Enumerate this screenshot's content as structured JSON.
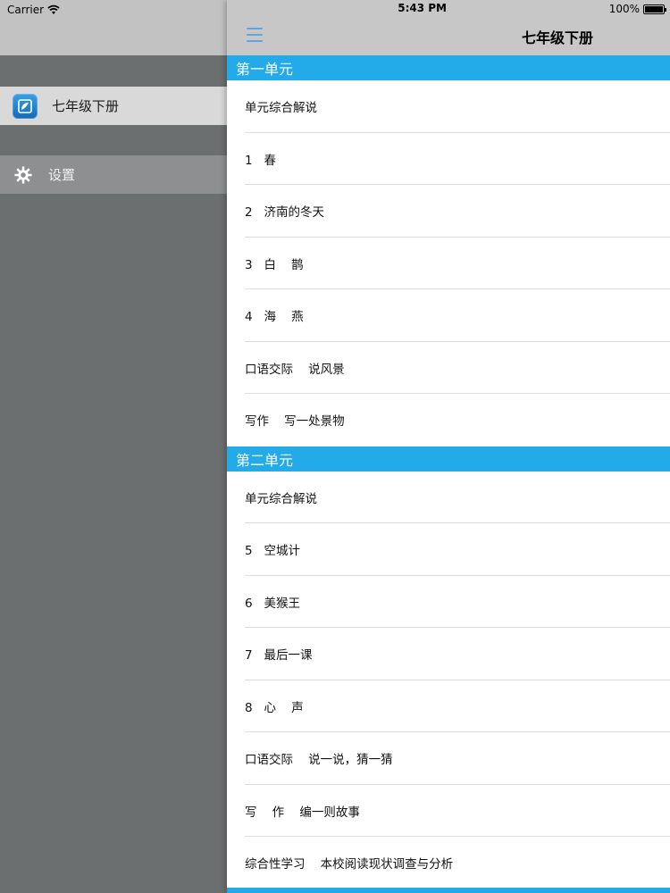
{
  "status": {
    "carrier": "Carrier",
    "time": "5:43 PM",
    "battery": "100%"
  },
  "sidebar": {
    "items": [
      {
        "label": "七年级下册",
        "icon": "book-app-icon"
      },
      {
        "label": "设置",
        "icon": "gear-icon"
      }
    ]
  },
  "header": {
    "title": "七年级下册",
    "menu_icon": "hamburger-menu-icon"
  },
  "sections": [
    {
      "title": "第一单元",
      "rows": [
        "单元综合解说",
        "1   春",
        "2   济南的冬天",
        "3   白    鹊",
        "4   海    燕",
        "口语交际    说风景",
        "写作    写一处景物"
      ]
    },
    {
      "title": "第二单元",
      "rows": [
        "单元综合解说",
        "5   空城计",
        "6   美猴王",
        "7   最后一课",
        "8   心    声",
        "口语交际    说一说，猜一猜",
        "写    作    编一则故事",
        "综合性学习    本校阅读现状调查与分析"
      ]
    }
  ],
  "colors": {
    "accent": "#22abe8",
    "sidebar_bg": "#6b6f70",
    "menu_icon": "#5fa6e0"
  }
}
